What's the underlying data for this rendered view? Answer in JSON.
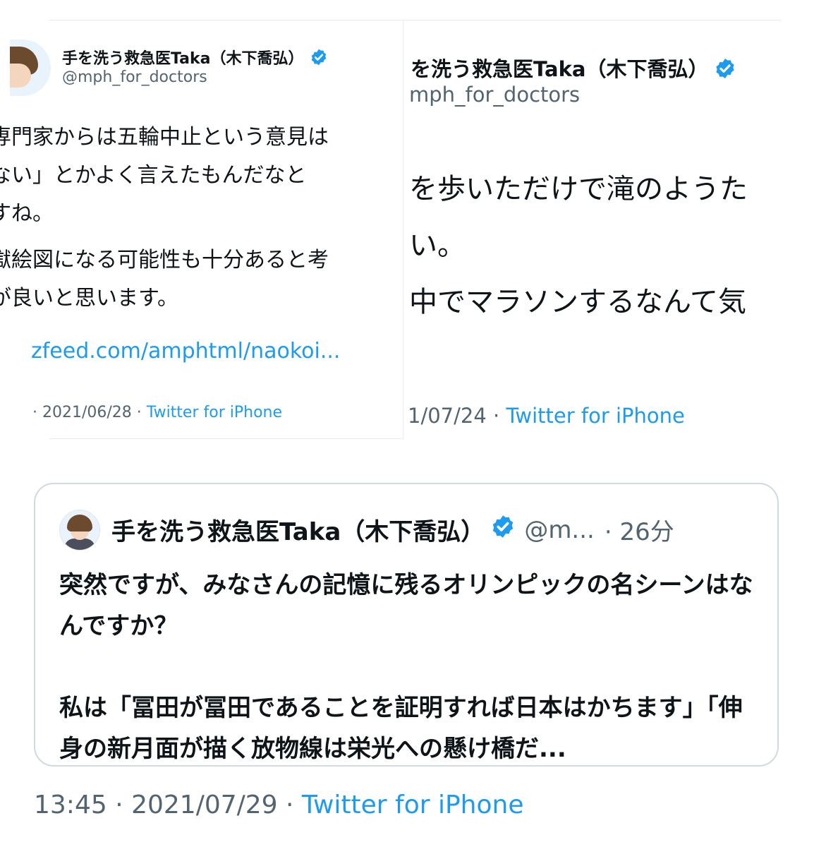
{
  "left_tweet": {
    "author_name": "手を洗う救急医Taka（木下喬弘）",
    "handle": "@mph_for_doctors",
    "body_lines": [
      "専門家からは五輪中止という意見は",
      "ない」とかよく言えたもんだなと",
      "すね。",
      "獄絵図になる可能性も十分あると考",
      "が良いと思います。"
    ],
    "link": "zfeed.com/amphtml/naokoi...",
    "date": "· 2021/06/28",
    "separator": " · ",
    "source": "Twitter for iPhone"
  },
  "right_tweet": {
    "author_name": "を洗う救急医Taka（木下喬弘）",
    "handle": "mph_for_doctors",
    "body_lines": [
      "を歩いただけで滝のようた",
      "い。",
      "中でマラソンするなんて気"
    ],
    "date": "1/07/24",
    "separator": " · ",
    "source": "Twitter for iPhone"
  },
  "quote_tweet": {
    "author_name": "手を洗う救急医Taka（木下喬弘）",
    "handle": "@m...",
    "time": "· 26分",
    "paragraph1": "突然ですが、みなさんの記憶に残るオリンピックの名シーンはなんですか？",
    "paragraph2": "私は「冨田が冨田であることを証明すれば日本はかちます」「伸身の新月面が描く放物線は栄光への懸け橋だ..."
  },
  "footer": {
    "time": "13:45",
    "date": "· 2021/07/29 ·",
    "source": "Twitter for iPhone"
  },
  "colors": {
    "link_blue": "#1d9bf0",
    "muted_gray": "#536471",
    "border": "#cfd9de",
    "verified_blue": "#1d9bf0"
  },
  "icons": [
    "verified-badge-icon",
    "avatar-image"
  ]
}
